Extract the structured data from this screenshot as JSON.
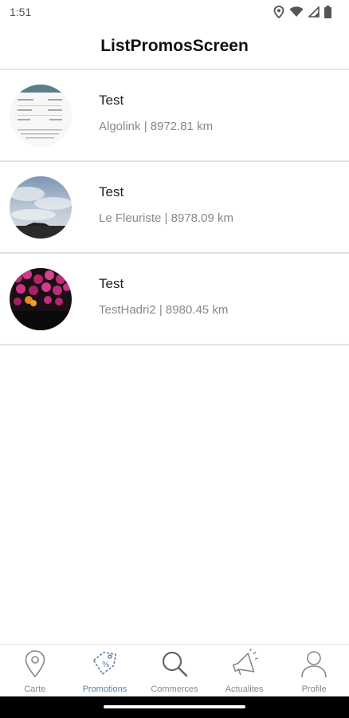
{
  "status_bar": {
    "time": "1:51",
    "icons": [
      "location-icon",
      "wifi-icon",
      "signal-icon",
      "battery-icon"
    ]
  },
  "header": {
    "title": "ListPromosScreen"
  },
  "promos": [
    {
      "title": "Test",
      "subtitle": "Algolink | 8972.81 km",
      "image": "document-thumbnail"
    },
    {
      "title": "Test",
      "subtitle": "Le Fleuriste | 8978.09 km",
      "image": "sky-landscape-thumbnail"
    },
    {
      "title": "Test",
      "subtitle": "TestHadri2 | 8980.45 km",
      "image": "flowers-thumbnail"
    }
  ],
  "bottom_nav": {
    "active": "promotions",
    "tabs": [
      {
        "id": "carte",
        "label": "Carte",
        "icon": "map-pin-icon"
      },
      {
        "id": "promotions",
        "label": "Promotions",
        "icon": "tag-icon"
      },
      {
        "id": "commerces",
        "label": "Commerces",
        "icon": "search-icon"
      },
      {
        "id": "actualites",
        "label": "Actualites",
        "icon": "megaphone-icon"
      },
      {
        "id": "profile",
        "label": "Profile",
        "icon": "user-icon"
      }
    ]
  },
  "colors": {
    "active_tab": "#5b7fa8",
    "inactive_tab": "#888888",
    "title_text": "#222222",
    "subtitle_text": "#888888",
    "divider": "#e2e2e2"
  }
}
